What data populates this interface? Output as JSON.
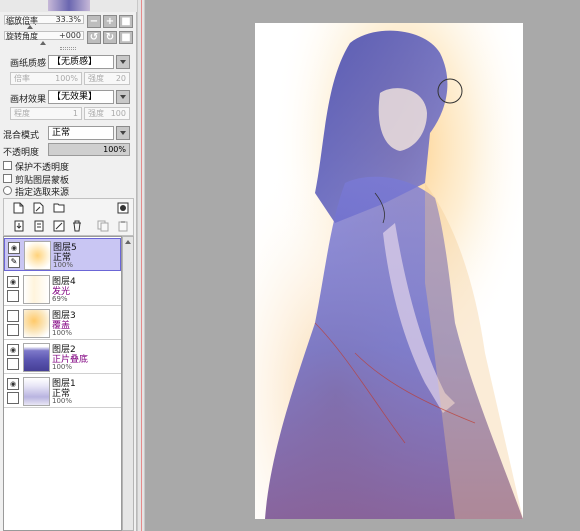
{
  "nav": {
    "zoom_label": "缩放倍率",
    "zoom_value": "33.3%",
    "rotate_label": "旋转角度",
    "rotate_value": "+000",
    "buttons": [
      "minus",
      "plus",
      "reset"
    ],
    "rotate_buttons": [
      "rotate-left",
      "rotate-right",
      "rotate-reset"
    ]
  },
  "paper_texture": {
    "label": "画纸质感",
    "value": "【无质感】",
    "scale_label": "倍率",
    "scale_value": "100%",
    "strength_label": "强度",
    "strength_value": "20"
  },
  "material_effect": {
    "label": "画材效果",
    "value": "【无效果】",
    "degree_label": "程度",
    "degree_value": "1",
    "strength_label": "强度",
    "strength_value": "100"
  },
  "blend": {
    "label": "混合模式",
    "value": "正常"
  },
  "opacity": {
    "label": "不透明度",
    "value": "100%",
    "fraction": 1.0
  },
  "options": [
    {
      "label": "保护不透明度",
      "type": "checkbox",
      "checked": false
    },
    {
      "label": "剪贴图层蒙板",
      "type": "checkbox",
      "checked": false
    },
    {
      "label": "指定选取来源",
      "type": "radio",
      "checked": false
    }
  ],
  "layers": [
    {
      "name": "图层5",
      "mode": "正常",
      "opacity": "100%",
      "selected": true,
      "visible": true,
      "locked_icon": "brush",
      "mode_color": "#111111",
      "thumb": "yellow-glow"
    },
    {
      "name": "图层4",
      "mode": "发光",
      "opacity": "69%",
      "selected": false,
      "visible": true,
      "mode_color": "#800080",
      "thumb": "pale"
    },
    {
      "name": "图层3",
      "mode": "覆盖",
      "opacity": "100%",
      "selected": false,
      "visible": false,
      "mode_color": "#800080",
      "thumb": "orange"
    },
    {
      "name": "图层2",
      "mode": "正片叠底",
      "opacity": "100%",
      "selected": false,
      "visible": true,
      "mode_color": "#800080",
      "thumb": "figure-dark"
    },
    {
      "name": "图层1",
      "mode": "正常",
      "opacity": "100%",
      "selected": false,
      "visible": true,
      "mode_color": "#111111",
      "thumb": "figure-line"
    }
  ],
  "colors": {
    "panel_bg": "#f0f0f0",
    "canvas_bg": "#a9a9a9",
    "selected_layer": "#c9c6f3",
    "purple_mode": "#800080"
  }
}
